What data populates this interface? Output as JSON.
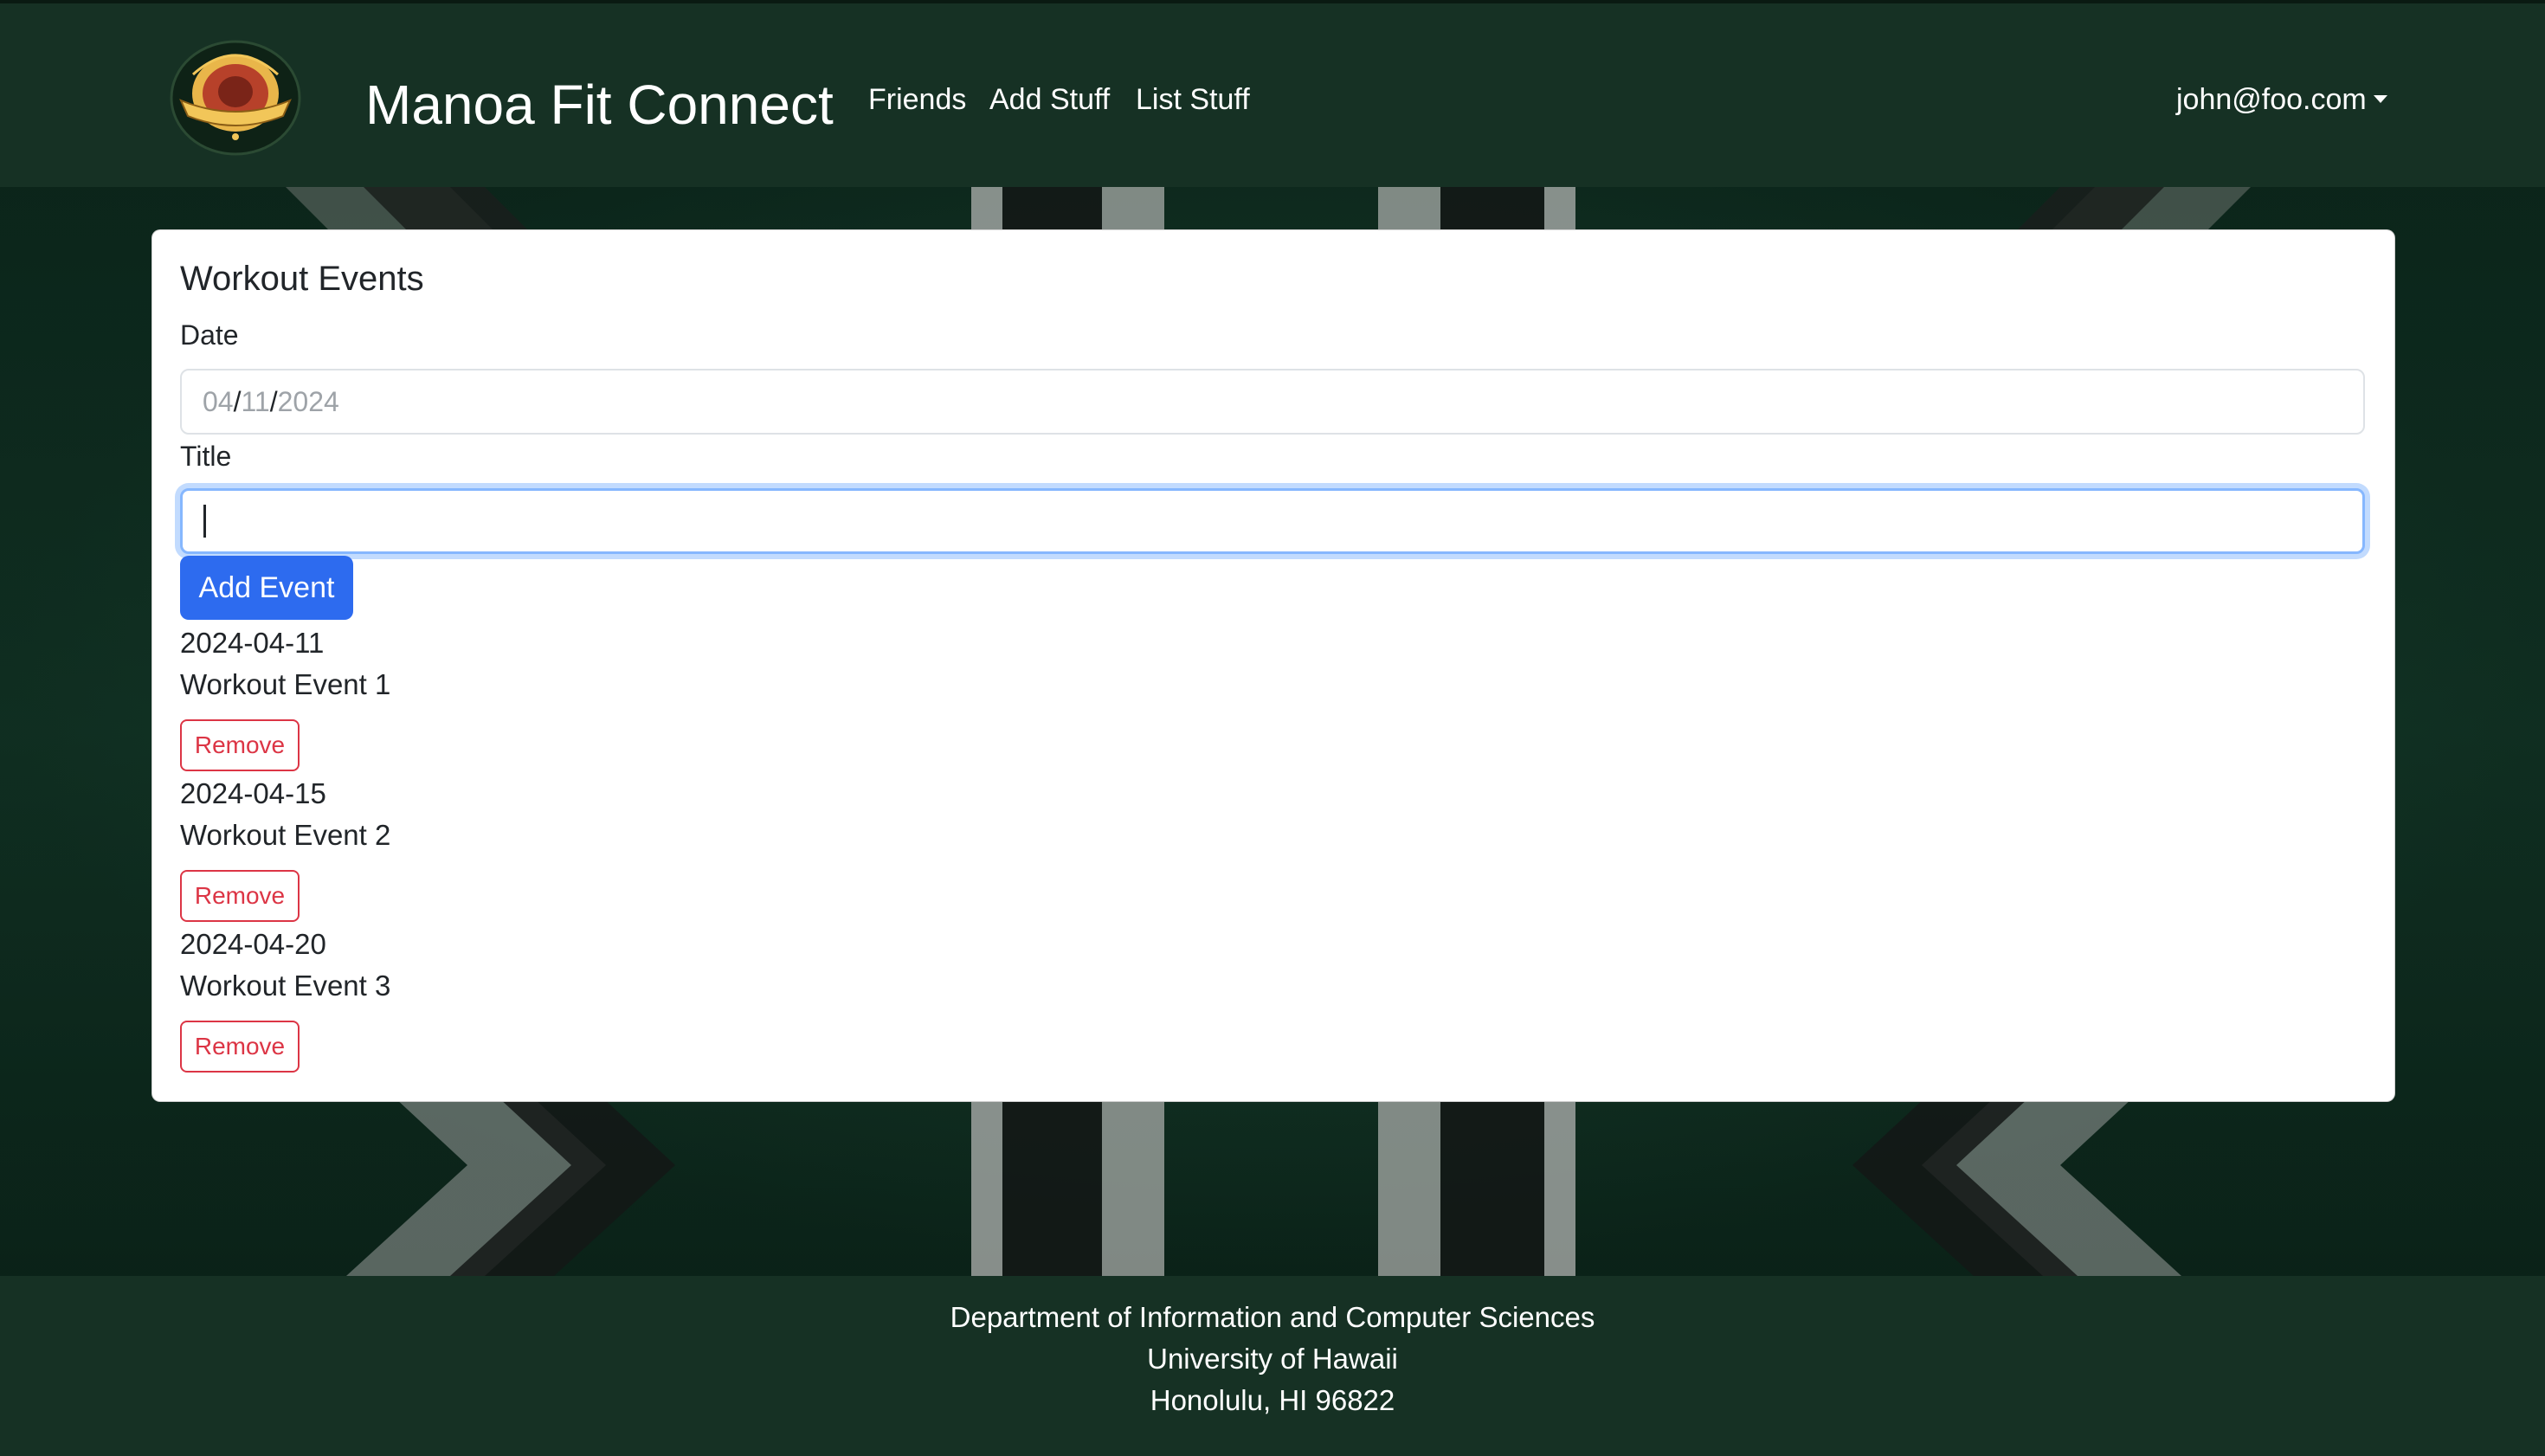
{
  "navbar": {
    "brand": "Manoa Fit Connect",
    "links": [
      {
        "label": "Friends"
      },
      {
        "label": "Add Stuff"
      },
      {
        "label": "List Stuff"
      }
    ],
    "user": "john@foo.com",
    "logo_icon": "manoa-fit-connect-logo"
  },
  "card": {
    "title": "Workout Events",
    "date_label": "Date",
    "date_value": {
      "month": "04",
      "day": "11",
      "year": "2024",
      "separator": "/"
    },
    "title_label": "Title",
    "title_value": "",
    "add_button": "Add Event",
    "events": [
      {
        "date": "2024-04-11",
        "title": "Workout Event 1",
        "remove_label": "Remove"
      },
      {
        "date": "2024-04-15",
        "title": "Workout Event 2",
        "remove_label": "Remove"
      },
      {
        "date": "2024-04-20",
        "title": "Workout Event 3",
        "remove_label": "Remove"
      }
    ]
  },
  "footer": {
    "lines": [
      "Department of Information and Computer Sciences",
      "University of Hawaii",
      "Honolulu, HI 96822"
    ]
  },
  "colors": {
    "navbar_bg": "#163124",
    "primary": "#2d6bef",
    "danger": "#dc3545",
    "focus_ring": "#86b7fe"
  }
}
